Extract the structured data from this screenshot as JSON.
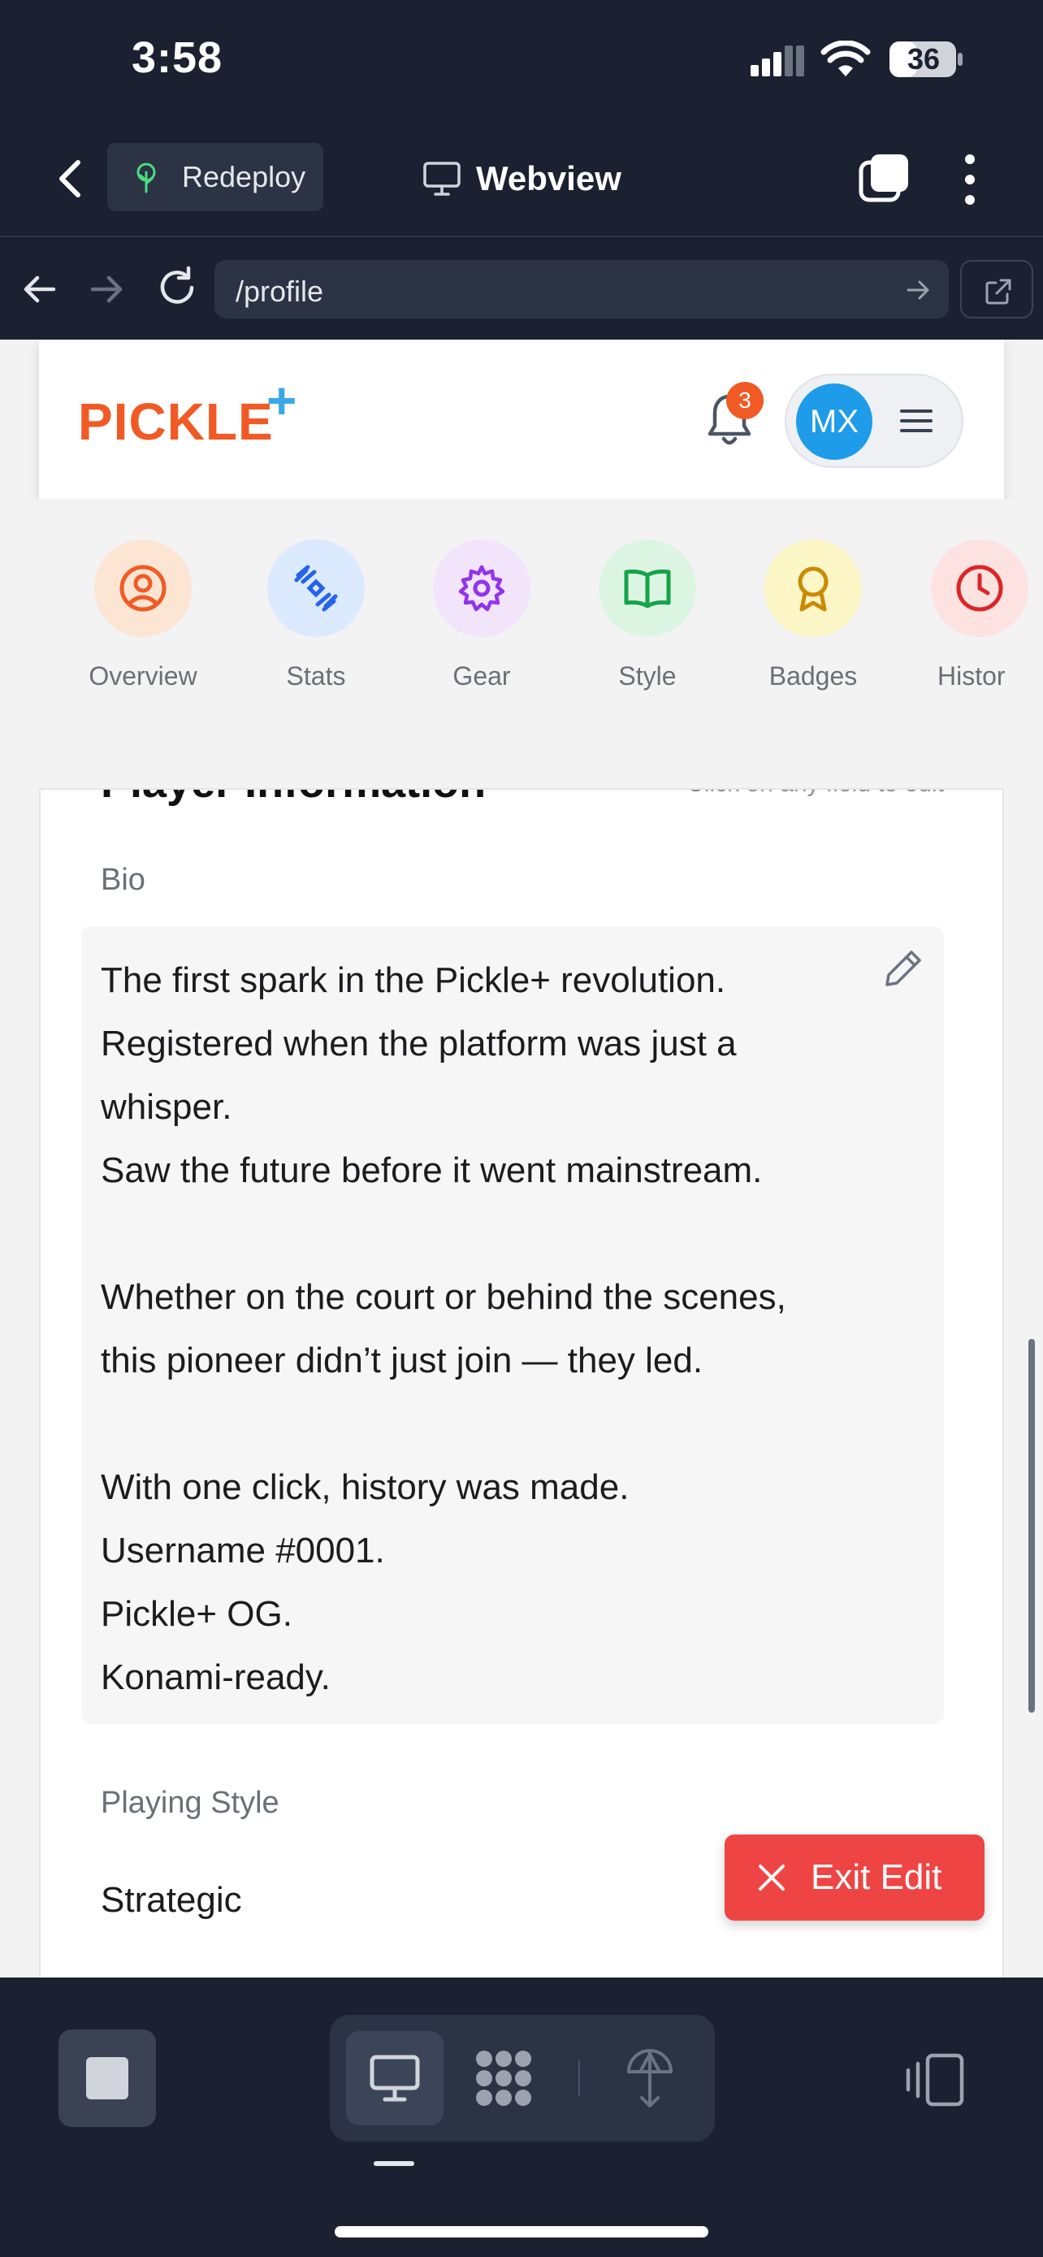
{
  "status": {
    "time": "3:58",
    "battery": "36"
  },
  "appbar": {
    "redeploy": "Redeploy",
    "title": "Webview"
  },
  "browser": {
    "url": "/profile"
  },
  "site": {
    "logo": "PICKLE",
    "logo_plus": "+",
    "notifications": "3",
    "avatar_initials": "MX"
  },
  "profile_tabs": [
    {
      "label": "Overview",
      "icon": "user-circle-icon",
      "bg": "#fde5d4",
      "fg": "#f15a24"
    },
    {
      "label": "Stats",
      "icon": "dumbbell-icon",
      "bg": "#dbeafe",
      "fg": "#2563eb"
    },
    {
      "label": "Gear",
      "icon": "gear-icon",
      "bg": "#f1e4fb",
      "fg": "#9333ea"
    },
    {
      "label": "Style",
      "icon": "book-icon",
      "bg": "#dcf5e3",
      "fg": "#16a34a"
    },
    {
      "label": "Badges",
      "icon": "award-icon",
      "bg": "#fdf6c7",
      "fg": "#ca8a04"
    },
    {
      "label": "Histor",
      "icon": "clock-icon",
      "bg": "#fde2e2",
      "fg": "#dc2626"
    }
  ],
  "card": {
    "title": "Player Information",
    "hint": "Click on any field to edit",
    "bio_label": "Bio",
    "bio_text": "The first spark in the Pickle+ revolution.\nRegistered when the platform was just a\nwhisper.\nSaw the future before it went mainstream.\n\nWhether on the court or behind the scenes,\nthis pioneer didn’t just join — they led.\n\nWith one click, history was made.\nUsername #0001.\nPickle+ OG.\nKonami-ready.",
    "style_label": "Playing Style",
    "style_value": "Strategic"
  },
  "exit_edit": "Exit Edit",
  "colors": {
    "accent": "#f15a24",
    "danger": "#ef4444",
    "avatar": "#1e9be9",
    "chrome": "#1b2130"
  }
}
